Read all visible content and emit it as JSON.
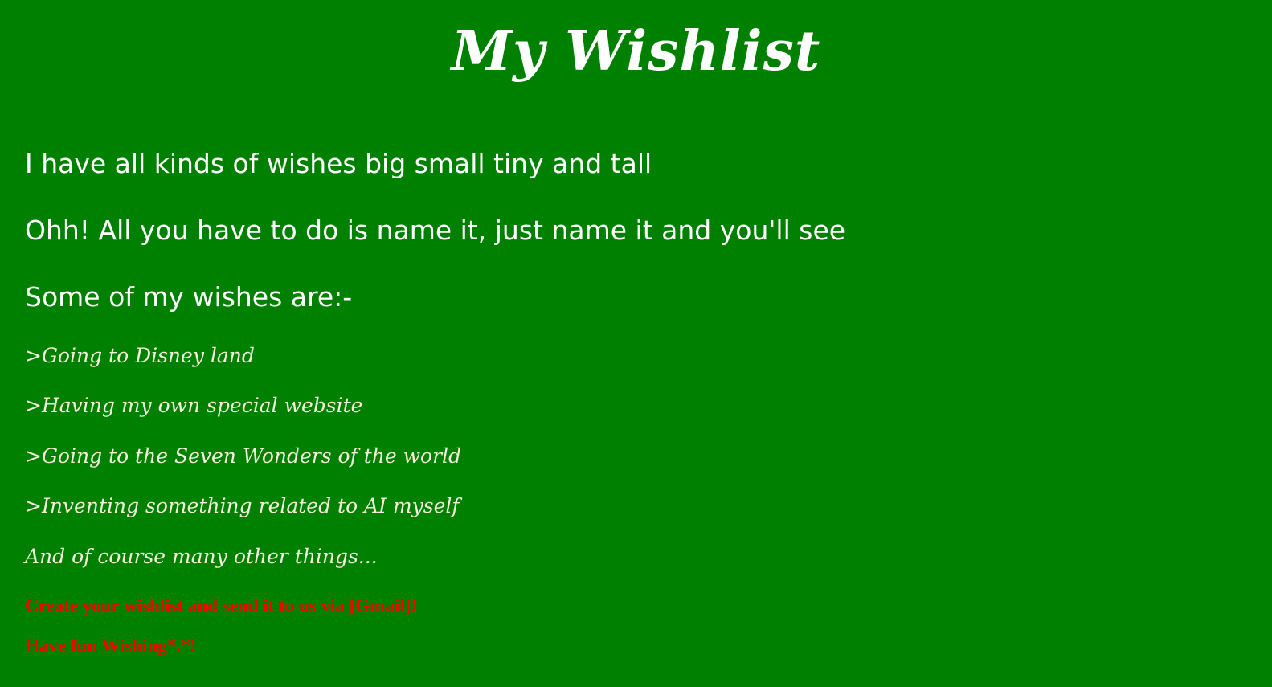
{
  "page": {
    "title": "My Wishlist",
    "intro_lines": [
      "I have all kinds of wishes big small tiny and tall",
      "Ohh! All you have to do is name it, just name it and you'll see",
      "Some of my wishes are:-"
    ],
    "wishes": [
      ">Going to Disney land",
      ">Having my own special website",
      ">Going to the Seven Wonders of the world",
      ">Inventing something related to AI myself"
    ],
    "closing": "And of course many other things...",
    "call_to_action": "Create your wishlist and send it to us via [Gmail]!",
    "sign_off": "Have fun Wishing*.*!"
  },
  "colors": {
    "background": "#008000",
    "text": "#ffffff",
    "wish_text": "#f5f0dc",
    "accent": "#ff0000"
  }
}
